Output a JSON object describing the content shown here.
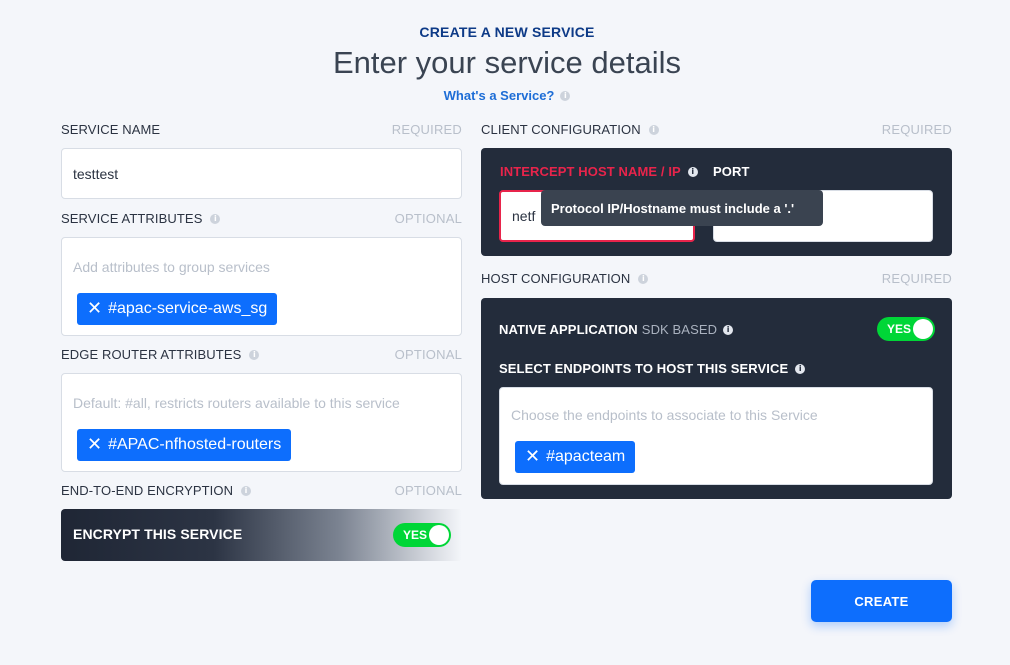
{
  "header": {
    "eyebrow": "CREATE A NEW SERVICE",
    "title": "Enter your service details",
    "whats_link": "What's a Service?"
  },
  "left": {
    "service_name": {
      "label": "SERVICE NAME",
      "hint": "REQUIRED",
      "value": "testtest"
    },
    "service_attributes": {
      "label": "SERVICE ATTRIBUTES",
      "hint": "OPTIONAL",
      "placeholder": "Add attributes to group services",
      "chips": [
        "#apac-service-aws_sg"
      ]
    },
    "edge_router_attributes": {
      "label": "EDGE ROUTER ATTRIBUTES",
      "hint": "OPTIONAL",
      "placeholder": "Default: #all, restricts routers available to this service",
      "chips": [
        "#APAC-nfhosted-routers"
      ]
    },
    "encryption": {
      "label": "END-TO-END ENCRYPTION",
      "hint": "OPTIONAL",
      "bar_text": "ENCRYPT THIS SERVICE",
      "toggle": "YES"
    }
  },
  "right": {
    "client_config": {
      "label": "CLIENT CONFIGURATION",
      "hint": "REQUIRED",
      "intercept_label": "INTERCEPT HOST NAME / IP",
      "port_label": "PORT",
      "intercept_value": "netf",
      "tooltip": "Protocol IP/Hostname must include a '.'"
    },
    "host_config": {
      "label": "HOST CONFIGURATION",
      "hint": "REQUIRED",
      "native_label": "NATIVE APPLICATION",
      "native_sub": "SDK BASED",
      "toggle": "YES",
      "endpoints_label": "SELECT ENDPOINTS TO HOST THIS SERVICE",
      "endpoints_placeholder": "Choose the endpoints to associate to this Service",
      "chips": [
        "#apacteam"
      ]
    }
  },
  "actions": {
    "create": "CREATE"
  },
  "icons": {
    "info": "info-icon",
    "remove": "close-icon"
  },
  "colors": {
    "accent": "#0d6efd",
    "toggle_on": "#00d637",
    "error": "#e8244b",
    "panel": "#232c3b"
  }
}
